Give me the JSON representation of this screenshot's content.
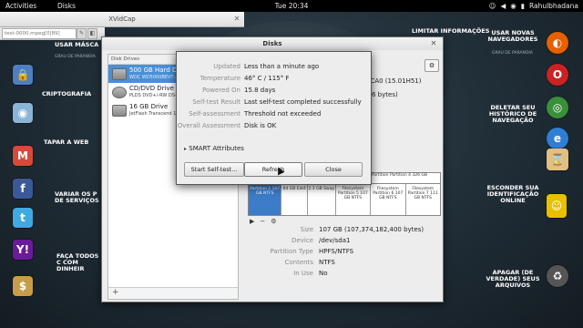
{
  "topbar": {
    "activities": "Activities",
    "app": "Disks",
    "clock": "Tue 20:34",
    "user": "Rahulbhadana"
  },
  "xvidcap": {
    "title": "XVidCap",
    "file": "test-0000.mpeg[0|89]"
  },
  "wallpaper": {
    "headings": [
      "USAR MÁSCA",
      "CRIPTOGRAFIA",
      "TAPAR A WEB",
      "VARIAR OS P DE SERVIÇOS",
      "FAÇA TODOS C COM DINHEIR",
      "LIMITAR INFORMAÇÕES",
      "USAR NOVAS NAVEGADORES",
      "DELETAR SEU HISTÓRICO DE NAVEGAÇÃO",
      "ESCONDER SUA IDENTIFICAÇÃO ONLINE",
      "APAGAR (DE VERDADE) SEUS ARQUIVOS"
    ],
    "sub": "GRAU DE PARANÓIA"
  },
  "disks": {
    "title": "Disks",
    "list_header": "Disk Drives",
    "drives": [
      {
        "name": "500 GB Hard Disk",
        "sub": "WDC WD5000BEVT-...",
        "selected": true
      },
      {
        "name": "CD/DVD Drive",
        "sub": "PLDS DVD+/-RW DS-8A8SH",
        "selected": false
      },
      {
        "name": "16 GB Drive",
        "sub": "JetFlash Transcend 16GB",
        "selected": false
      }
    ],
    "bg_model": "3CA0 (15.01H51)",
    "bg_bytes": "6 bytes)",
    "extended": "Extended Partition Partition 4 326 GB",
    "partitions": [
      {
        "label": "Partition 1 107 GB NTFS",
        "selected": true
      },
      {
        "label": "64 GB Ext4",
        "selected": false
      },
      {
        "label": "2.1 GB Swap",
        "selected": false
      },
      {
        "label": "Filesystem Partition 5 107 GB NTFS",
        "selected": false
      },
      {
        "label": "Filesystem Partition 6 107 GB NTFS",
        "selected": false
      },
      {
        "label": "Filesystem Partition 7 111 GB NTFS",
        "selected": false
      }
    ],
    "partinfo": [
      {
        "k": "Size",
        "v": "107 GB (107,374,182,400 bytes)"
      },
      {
        "k": "Device",
        "v": "/dev/sda1"
      },
      {
        "k": "Partition Type",
        "v": "HPFS/NTFS"
      },
      {
        "k": "Contents",
        "v": "NTFS"
      },
      {
        "k": "In Use",
        "v": "No"
      }
    ]
  },
  "smart": {
    "rows": [
      {
        "k": "Updated",
        "v": "Less than a minute ago"
      },
      {
        "k": "Temperature",
        "v": "46° C / 115° F"
      },
      {
        "k": "Powered On",
        "v": "15.8 days"
      },
      {
        "k": "Self-test Result",
        "v": "Last self-test completed successfully"
      },
      {
        "k": "Self-assessment",
        "v": "Threshold not exceeded"
      },
      {
        "k": "Overall Assessment",
        "v": "Disk is OK"
      }
    ],
    "attributes": "SMART Attributes",
    "start_label": "Start Self-test...",
    "refresh_label": "Refresh",
    "close_label": "Close"
  }
}
